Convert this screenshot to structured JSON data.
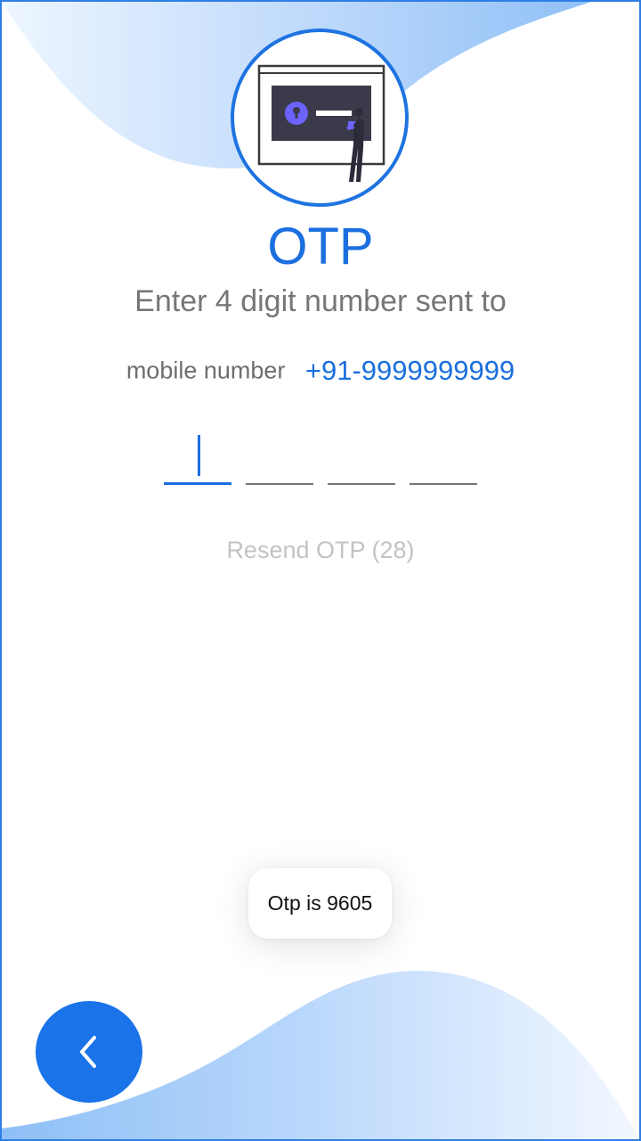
{
  "header": {
    "title": "OTP",
    "subtitle": "Enter 4 digit number sent to"
  },
  "mobile": {
    "label": "mobile number",
    "number": "+91-9999999999"
  },
  "otp": {
    "digits": [
      "",
      "",
      "",
      ""
    ],
    "active_index": 0
  },
  "resend": {
    "label": "Resend OTP (28)"
  },
  "toast": {
    "message": "Otp is 9605"
  },
  "back_button": {
    "icon": "chevron-left-icon"
  },
  "colors": {
    "accent": "#1b6fdf",
    "wave_light": "#e6f1ff",
    "wave_mid": "#a6cbf8",
    "muted_text": "#777777",
    "disabled_text": "#c3c3c3"
  }
}
